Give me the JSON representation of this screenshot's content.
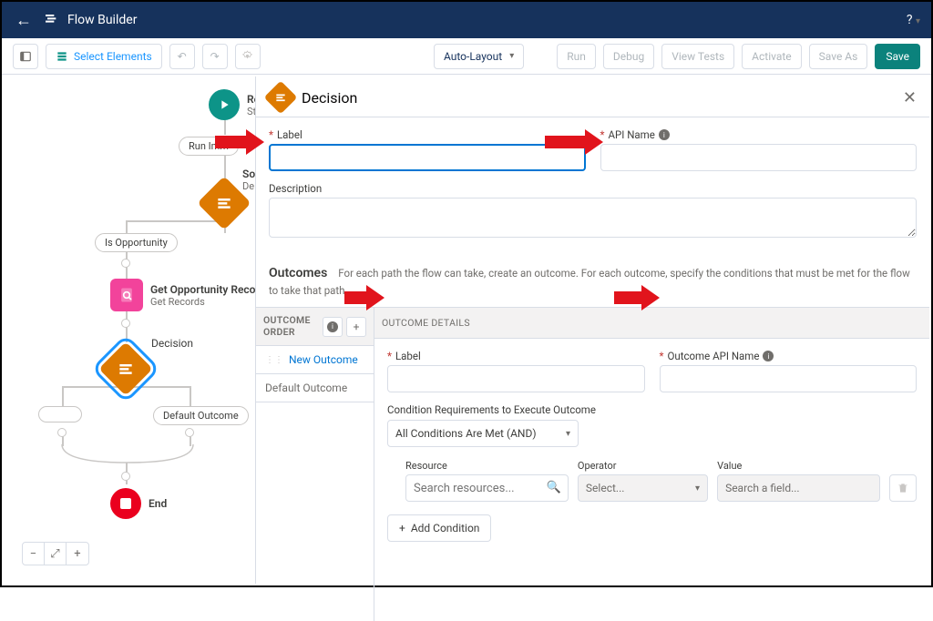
{
  "topnav": {
    "title": "Flow Builder",
    "help": "?"
  },
  "toolbar": {
    "select": "Select Elements",
    "autolayout": "Auto-Layout",
    "run": "Run",
    "debug": "Debug",
    "viewtests": "View Tests",
    "activate": "Activate",
    "saveas": "Save As",
    "save": "Save"
  },
  "canvas": {
    "startTitle": "Re",
    "startSub": "Sta",
    "runImmediately": "Run Imm",
    "someNode": "So",
    "someNodeSub": "De",
    "isOpportunity": "Is Opportunity",
    "getOppTitle": "Get Opportunity Record",
    "getOppSub": "Get Records",
    "decisionLabel": "Decision",
    "defaultOutcome": "Default Outcome",
    "end": "End"
  },
  "panel": {
    "title": "Decision",
    "labelField": "Label",
    "apiNameField": "API Name",
    "descField": "Description",
    "outcomesTitle": "Outcomes",
    "outcomesDesc": "For each path the flow can take, create an outcome. For each outcome, specify the conditions that must be met for the flow to take that path.",
    "outcomeOrder": "OUTCOME\nORDER",
    "newOutcome": "New Outcome",
    "defaultOutcome": "Default Outcome",
    "outcomeDetails": "OUTCOME DETAILS",
    "outLabel": "Label",
    "outApi": "Outcome API Name",
    "condReq": "Condition Requirements to Execute Outcome",
    "condMode": "All Conditions Are Met (AND)",
    "resource": "Resource",
    "resourcePlaceholder": "Search resources...",
    "operator": "Operator",
    "operatorPlaceholder": "Select...",
    "value": "Value",
    "valuePlaceholder": "Search a field...",
    "addCondition": "Add Condition"
  }
}
